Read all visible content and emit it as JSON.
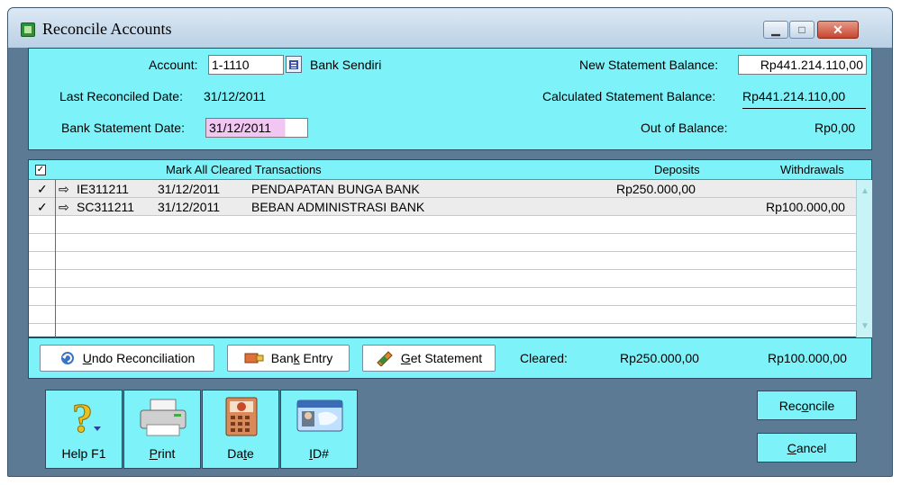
{
  "window": {
    "title": "Reconcile Accounts"
  },
  "account": {
    "account_label": "Account:",
    "account_number": "1-1110",
    "account_name": "Bank Sendiri",
    "last_reconciled_label": "Last Reconciled Date:",
    "last_reconciled_value": "31/12/2011",
    "statement_date_label": "Bank Statement Date:",
    "statement_date_value": "31/12/2011",
    "new_balance_label": "New Statement Balance:",
    "new_balance_value": "Rp441.214.110,00",
    "calculated_balance_label": "Calculated Statement Balance:",
    "calculated_balance_value": "Rp441.214.110,00",
    "out_of_balance_label": "Out of Balance:",
    "out_of_balance_value": "Rp0,00"
  },
  "grid": {
    "columns": {
      "mark_all": "Mark All Cleared Transactions",
      "deposits": "Deposits",
      "withdrawals": "Withdrawals"
    },
    "rows": [
      {
        "check": "✓",
        "id": "IE311211",
        "date": "31/12/2011",
        "memo": "PENDAPATAN BUNGA BANK",
        "deposit": "Rp250.000,00",
        "withdrawal": ""
      },
      {
        "check": "✓",
        "id": "SC311211",
        "date": "31/12/2011",
        "memo": "BEBAN ADMINISTRASI BANK",
        "deposit": "",
        "withdrawal": "Rp100.000,00"
      }
    ]
  },
  "actions": {
    "undo_prefix": "",
    "undo_key": "U",
    "undo_rest": "ndo Reconciliation",
    "bank_entry_prefix": "Ban",
    "bank_entry_key": "k",
    "bank_entry_rest": " Entry",
    "get_statement_prefix": "",
    "get_statement_key": "G",
    "get_statement_rest": "et Statement",
    "cleared_label": "Cleared:",
    "cleared_deposits": "Rp250.000,00",
    "cleared_withdrawals": "Rp100.000,00"
  },
  "toolbar": {
    "help_label": "Help F1",
    "print_key": "P",
    "print_rest": "rint",
    "date_prefix": "Da",
    "date_key": "t",
    "date_rest": "e",
    "id_key": "I",
    "id_rest": "D#"
  },
  "buttons": {
    "reconcile_prefix": "Rec",
    "reconcile_key": "o",
    "reconcile_rest": "ncile",
    "cancel_key": "C",
    "cancel_rest": "ancel"
  },
  "icons": {
    "help": "help-question-icon",
    "print": "printer-icon",
    "date": "calendar-icon",
    "id": "id-card-icon",
    "undo": "undo-icon",
    "bank_entry": "bank-entry-icon",
    "get_statement": "statement-icon"
  },
  "colors": {
    "panel": "#7df2f8",
    "frame": "#5c7a94",
    "highlight_field": "#f2c6f2"
  }
}
